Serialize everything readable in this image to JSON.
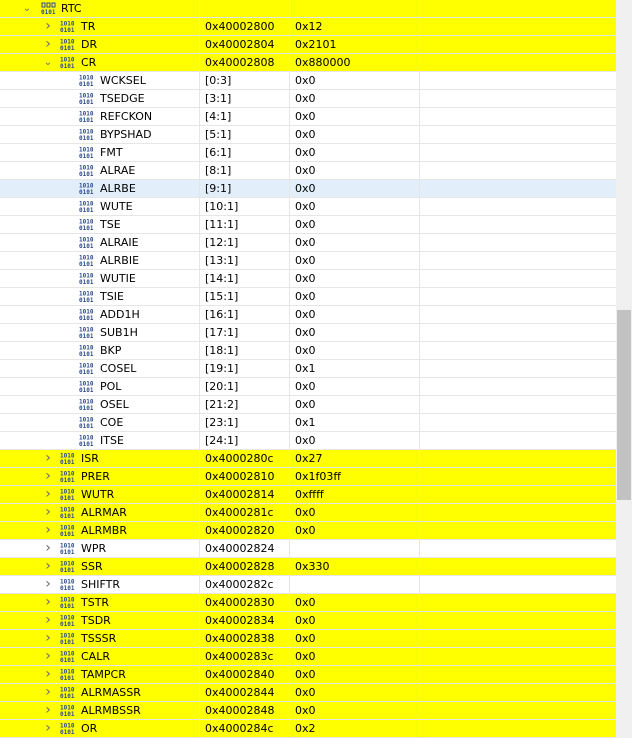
{
  "root": {
    "label": "RTC",
    "expanded": true
  },
  "rows": [
    {
      "name": "TR",
      "addr": "0x40002800",
      "value": "0x12",
      "type": "register",
      "expanded": false,
      "highlight": true
    },
    {
      "name": "DR",
      "addr": "0x40002804",
      "value": "0x2101",
      "type": "register",
      "expanded": false,
      "highlight": true
    },
    {
      "name": "CR",
      "addr": "0x40002808",
      "value": "0x880000",
      "type": "register",
      "expanded": true,
      "highlight": true
    },
    {
      "name": "WCKSEL",
      "addr": "[0:3]",
      "value": "0x0",
      "type": "field"
    },
    {
      "name": "TSEDGE",
      "addr": "[3:1]",
      "value": "0x0",
      "type": "field"
    },
    {
      "name": "REFCKON",
      "addr": "[4:1]",
      "value": "0x0",
      "type": "field"
    },
    {
      "name": "BYPSHAD",
      "addr": "[5:1]",
      "value": "0x0",
      "type": "field"
    },
    {
      "name": "FMT",
      "addr": "[6:1]",
      "value": "0x0",
      "type": "field"
    },
    {
      "name": "ALRAE",
      "addr": "[8:1]",
      "value": "0x0",
      "type": "field"
    },
    {
      "name": "ALRBE",
      "addr": "[9:1]",
      "value": "0x0",
      "type": "field",
      "selected": true
    },
    {
      "name": "WUTE",
      "addr": "[10:1]",
      "value": "0x0",
      "type": "field"
    },
    {
      "name": "TSE",
      "addr": "[11:1]",
      "value": "0x0",
      "type": "field"
    },
    {
      "name": "ALRAIE",
      "addr": "[12:1]",
      "value": "0x0",
      "type": "field"
    },
    {
      "name": "ALRBIE",
      "addr": "[13:1]",
      "value": "0x0",
      "type": "field"
    },
    {
      "name": "WUTIE",
      "addr": "[14:1]",
      "value": "0x0",
      "type": "field"
    },
    {
      "name": "TSIE",
      "addr": "[15:1]",
      "value": "0x0",
      "type": "field"
    },
    {
      "name": "ADD1H",
      "addr": "[16:1]",
      "value": "0x0",
      "type": "field"
    },
    {
      "name": "SUB1H",
      "addr": "[17:1]",
      "value": "0x0",
      "type": "field"
    },
    {
      "name": "BKP",
      "addr": "[18:1]",
      "value": "0x0",
      "type": "field"
    },
    {
      "name": "COSEL",
      "addr": "[19:1]",
      "value": "0x1",
      "type": "field"
    },
    {
      "name": "POL",
      "addr": "[20:1]",
      "value": "0x0",
      "type": "field"
    },
    {
      "name": "OSEL",
      "addr": "[21:2]",
      "value": "0x0",
      "type": "field"
    },
    {
      "name": "COE",
      "addr": "[23:1]",
      "value": "0x1",
      "type": "field"
    },
    {
      "name": "ITSE",
      "addr": "[24:1]",
      "value": "0x0",
      "type": "field"
    },
    {
      "name": "ISR",
      "addr": "0x4000280c",
      "value": "0x27",
      "type": "register",
      "expanded": false,
      "highlight": true
    },
    {
      "name": "PRER",
      "addr": "0x40002810",
      "value": "0x1f03ff",
      "type": "register",
      "expanded": false,
      "highlight": true
    },
    {
      "name": "WUTR",
      "addr": "0x40002814",
      "value": "0xffff",
      "type": "register",
      "expanded": false,
      "highlight": true
    },
    {
      "name": "ALRMAR",
      "addr": "0x4000281c",
      "value": "0x0",
      "type": "register",
      "expanded": false,
      "highlight": true
    },
    {
      "name": "ALRMBR",
      "addr": "0x40002820",
      "value": "0x0",
      "type": "register",
      "expanded": false,
      "highlight": true
    },
    {
      "name": "WPR",
      "addr": "0x40002824",
      "value": "",
      "type": "register",
      "expanded": false,
      "highlight": false
    },
    {
      "name": "SSR",
      "addr": "0x40002828",
      "value": "0x330",
      "type": "register",
      "expanded": false,
      "highlight": true
    },
    {
      "name": "SHIFTR",
      "addr": "0x4000282c",
      "value": "",
      "type": "register",
      "expanded": false,
      "highlight": false
    },
    {
      "name": "TSTR",
      "addr": "0x40002830",
      "value": "0x0",
      "type": "register",
      "expanded": false,
      "highlight": true
    },
    {
      "name": "TSDR",
      "addr": "0x40002834",
      "value": "0x0",
      "type": "register",
      "expanded": false,
      "highlight": true
    },
    {
      "name": "TSSSR",
      "addr": "0x40002838",
      "value": "0x0",
      "type": "register",
      "expanded": false,
      "highlight": true
    },
    {
      "name": "CALR",
      "addr": "0x4000283c",
      "value": "0x0",
      "type": "register",
      "expanded": false,
      "highlight": true
    },
    {
      "name": "TAMPCR",
      "addr": "0x40002840",
      "value": "0x0",
      "type": "register",
      "expanded": false,
      "highlight": true
    },
    {
      "name": "ALRMASSR",
      "addr": "0x40002844",
      "value": "0x0",
      "type": "register",
      "expanded": false,
      "highlight": true
    },
    {
      "name": "ALRMBSSR",
      "addr": "0x40002848",
      "value": "0x0",
      "type": "register",
      "expanded": false,
      "highlight": true
    },
    {
      "name": "OR",
      "addr": "0x4000284c",
      "value": "0x2",
      "type": "register",
      "expanded": false,
      "highlight": true
    }
  ],
  "icons": {
    "root": "peripheral-icon",
    "register": "register-icon",
    "field": "field-icon",
    "expanded": "chevron-down-icon",
    "collapsed": "chevron-right-icon"
  },
  "colors": {
    "highlight": "#ffff00",
    "selected": "#e2effb",
    "grid": "#e6e6e6"
  }
}
